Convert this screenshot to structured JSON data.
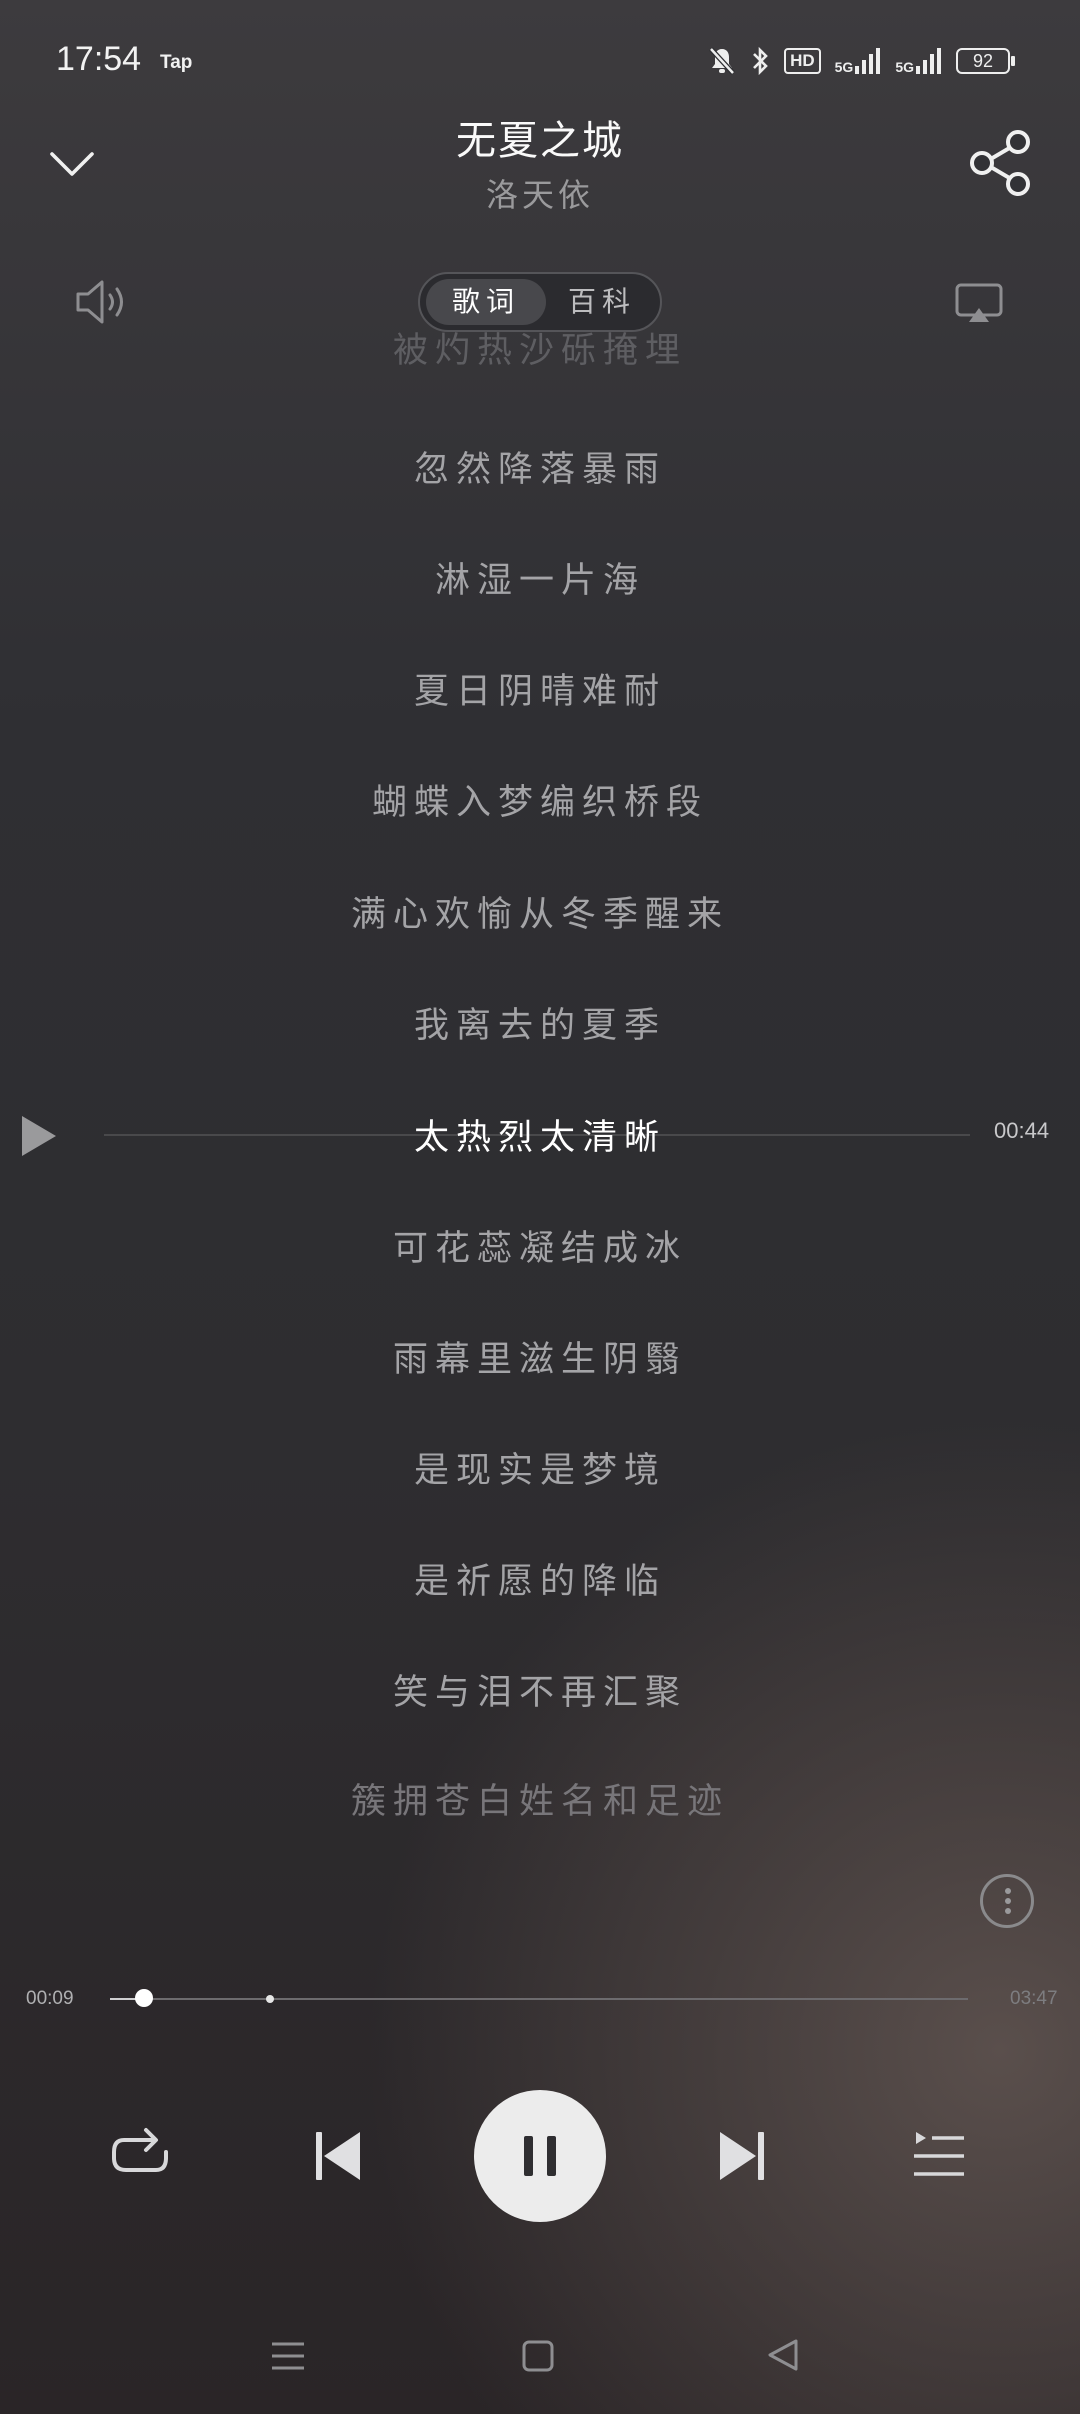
{
  "status_bar": {
    "time": "17:54",
    "tap_label": "Tap",
    "hd_label": "HD",
    "net1": "5G",
    "net2": "5G",
    "battery": "92"
  },
  "header": {
    "title": "无夏之城",
    "artist": "洛天依"
  },
  "tabs": [
    {
      "label": "歌词",
      "active": true
    },
    {
      "label": "百科",
      "active": false
    }
  ],
  "lyrics": {
    "lines": [
      "被灼热沙砾掩埋",
      "忽然降落暴雨",
      "淋湿一片海",
      "夏日阴晴难耐",
      "蝴蝶入梦编织桥段",
      "满心欢愉从冬季醒来",
      "我离去的夏季",
      "太热烈太清晰",
      "可花蕊凝结成冰",
      "雨幕里滋生阴翳",
      "是现实是梦境",
      "是祈愿的降临",
      "笑与泪不再汇聚",
      "簇拥苍白姓名和足迹"
    ],
    "current_index": 7,
    "current_time": "00:44"
  },
  "progress": {
    "elapsed": "00:09",
    "total": "03:47",
    "fraction": 0.04
  },
  "colors": {
    "accent": "#ffffff",
    "lyric_inactive": "#a4a4a7"
  },
  "icons": {
    "collapse": "chevron-down-icon",
    "share": "share-icon",
    "volume": "speaker-icon",
    "cast": "cast-icon",
    "more": "more-vertical-icon",
    "repeat": "repeat-icon",
    "prev": "skip-previous-icon",
    "play_pause": "pause-icon",
    "next": "skip-next-icon",
    "playlist": "playlist-icon"
  }
}
